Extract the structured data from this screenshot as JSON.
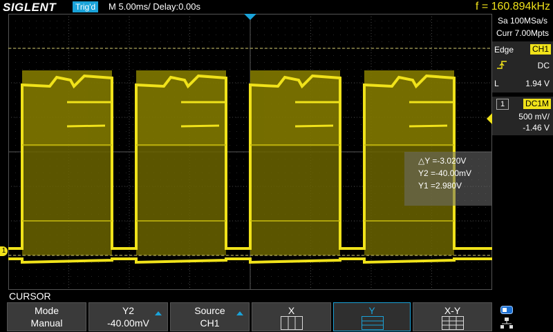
{
  "header": {
    "brand": "SIGLENT",
    "trigger_status": "Trig'd",
    "timebase": "M 5.00ms/ Delay:0.00s",
    "frequency": "f = 160.894kHz"
  },
  "acquisition": {
    "sample_rate": "Sa 100MSa/s",
    "memory_depth": "Curr 7.00Mpts"
  },
  "trigger_panel": {
    "type": "Edge",
    "source": "CH1",
    "coupling": "DC",
    "level_label": "L",
    "level": "1.94 V"
  },
  "channel_panel": {
    "number": "1",
    "coupling_impedance": "DC1M",
    "scale": "500 mV/",
    "offset": "-1.46 V"
  },
  "cursor_readout": {
    "delta_y": "△Y =-3.020V",
    "y2": "Y2 =-40.00mV",
    "y1": "Y1 =2.980V"
  },
  "menu": {
    "title": "CURSOR",
    "softkeys": [
      {
        "label": "Mode",
        "value": "Manual"
      },
      {
        "label": "Y2",
        "value": "-40.00mV"
      },
      {
        "label": "Source",
        "value": "CH1"
      },
      {
        "label": "X",
        "value": ""
      },
      {
        "label": "Y",
        "value": ""
      },
      {
        "label": "X-Y",
        "value": ""
      }
    ]
  },
  "channel_marker": "1",
  "colors": {
    "ch1": "#f0e21a",
    "accent": "#1aa3d9",
    "grid": "#4a4a4a"
  },
  "icons": [
    "trigger-rising-edge-icon",
    "network-icon",
    "usb-icon",
    "cursor-x-icon",
    "cursor-y-icon",
    "cursor-xy-icon"
  ]
}
